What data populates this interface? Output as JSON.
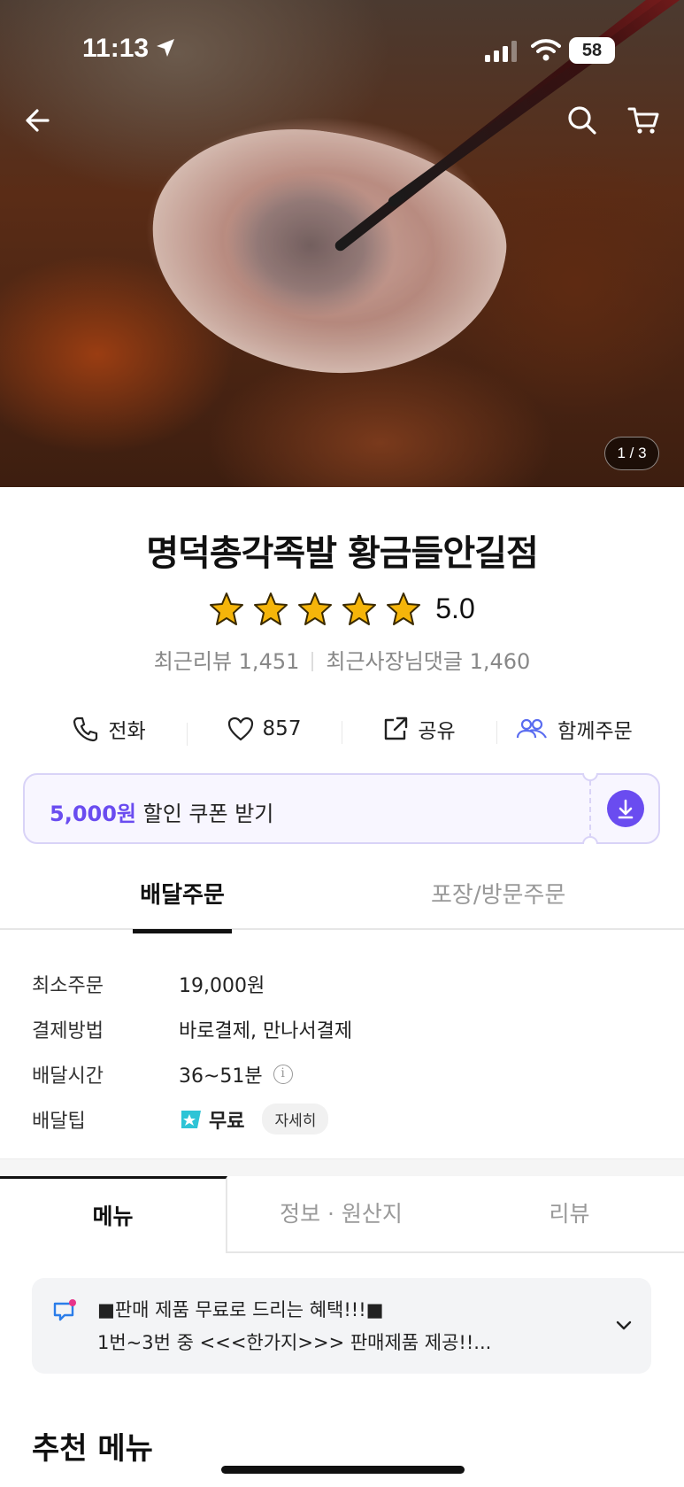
{
  "status_bar": {
    "time": "11:13",
    "battery": "58"
  },
  "hero": {
    "page_indicator": "1 / 3"
  },
  "store": {
    "name": "명덕총각족발 황금들안길점",
    "rating": "5.0",
    "recent_reviews": "최근리뷰 1,451",
    "owner_comments": "최근사장님댓글 1,460"
  },
  "actions": {
    "call": "전화",
    "likes": "857",
    "share": "공유",
    "group_order": "함께주문"
  },
  "coupon": {
    "amount": "5,000원",
    "text": " 할인 쿠폰 받기"
  },
  "order_tabs": {
    "delivery": "배달주문",
    "pickup": "포장/방문주문"
  },
  "info": {
    "min_order_label": "최소주문",
    "min_order_value": "19,000원",
    "payment_label": "결제방법",
    "payment_value": "바로결제, 만나서결제",
    "time_label": "배달시간",
    "time_value": "36~51분",
    "tip_label": "배달팁",
    "tip_value": "무료",
    "detail": "자세히"
  },
  "main_tabs": {
    "menu": "메뉴",
    "info": "정보 · 원산지",
    "review": "리뷰"
  },
  "notice": {
    "line1": "■판매 제품 무료로 드리는 혜택!!!■",
    "line2": "1번~3번 중 <<<한가지>>> 판매제품 제공!!..."
  },
  "recommended_title": "추천 메뉴",
  "colors": {
    "accent": "#6a4cf0",
    "free_badge": "#2ec4d6",
    "star": "#f5b50a"
  }
}
